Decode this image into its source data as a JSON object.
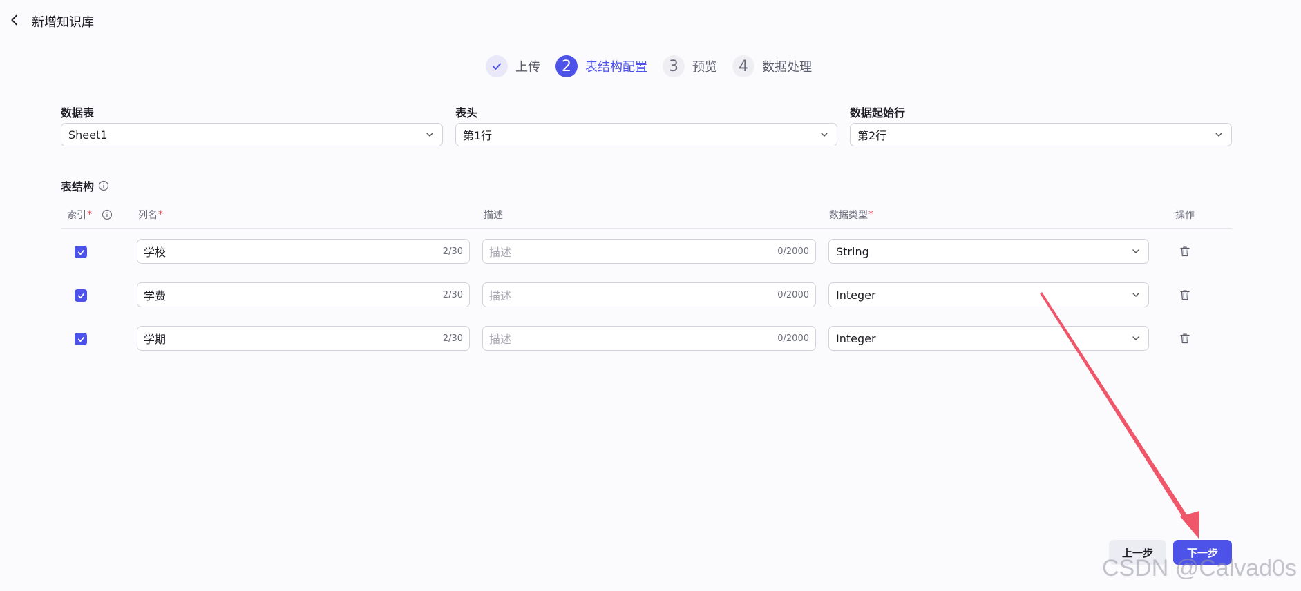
{
  "header": {
    "title": "新增知识库"
  },
  "stepper": {
    "steps": [
      {
        "num": "",
        "label": "上传",
        "state": "done"
      },
      {
        "num": "2",
        "label": "表结构配置",
        "state": "active"
      },
      {
        "num": "3",
        "label": "预览",
        "state": "pending"
      },
      {
        "num": "4",
        "label": "数据处理",
        "state": "pending"
      }
    ]
  },
  "config": {
    "sheet": {
      "label": "数据表",
      "value": "Sheet1"
    },
    "header_row": {
      "label": "表头",
      "value": "第1行"
    },
    "start_row": {
      "label": "数据起始行",
      "value": "第2行"
    }
  },
  "table": {
    "title": "表结构",
    "columns": {
      "index": "索引",
      "name": "列名",
      "desc": "描述",
      "type": "数据类型",
      "ops": "操作",
      "required_mark": "*"
    },
    "rows": [
      {
        "checked": true,
        "name": "学校",
        "name_count": "2/30",
        "desc_placeholder": "描述",
        "desc_count": "0/2000",
        "type": "String"
      },
      {
        "checked": true,
        "name": "学费",
        "name_count": "2/30",
        "desc_placeholder": "描述",
        "desc_count": "0/2000",
        "type": "Integer"
      },
      {
        "checked": true,
        "name": "学期",
        "name_count": "2/30",
        "desc_placeholder": "描述",
        "desc_count": "0/2000",
        "type": "Integer"
      }
    ]
  },
  "footer": {
    "prev_label": "上一步",
    "next_label": "下一步"
  },
  "watermark": "CSDN @Calvad0s",
  "colors": {
    "accent": "#4d53e8",
    "annotation_arrow": "#f0566a",
    "required": "#e5484d"
  }
}
